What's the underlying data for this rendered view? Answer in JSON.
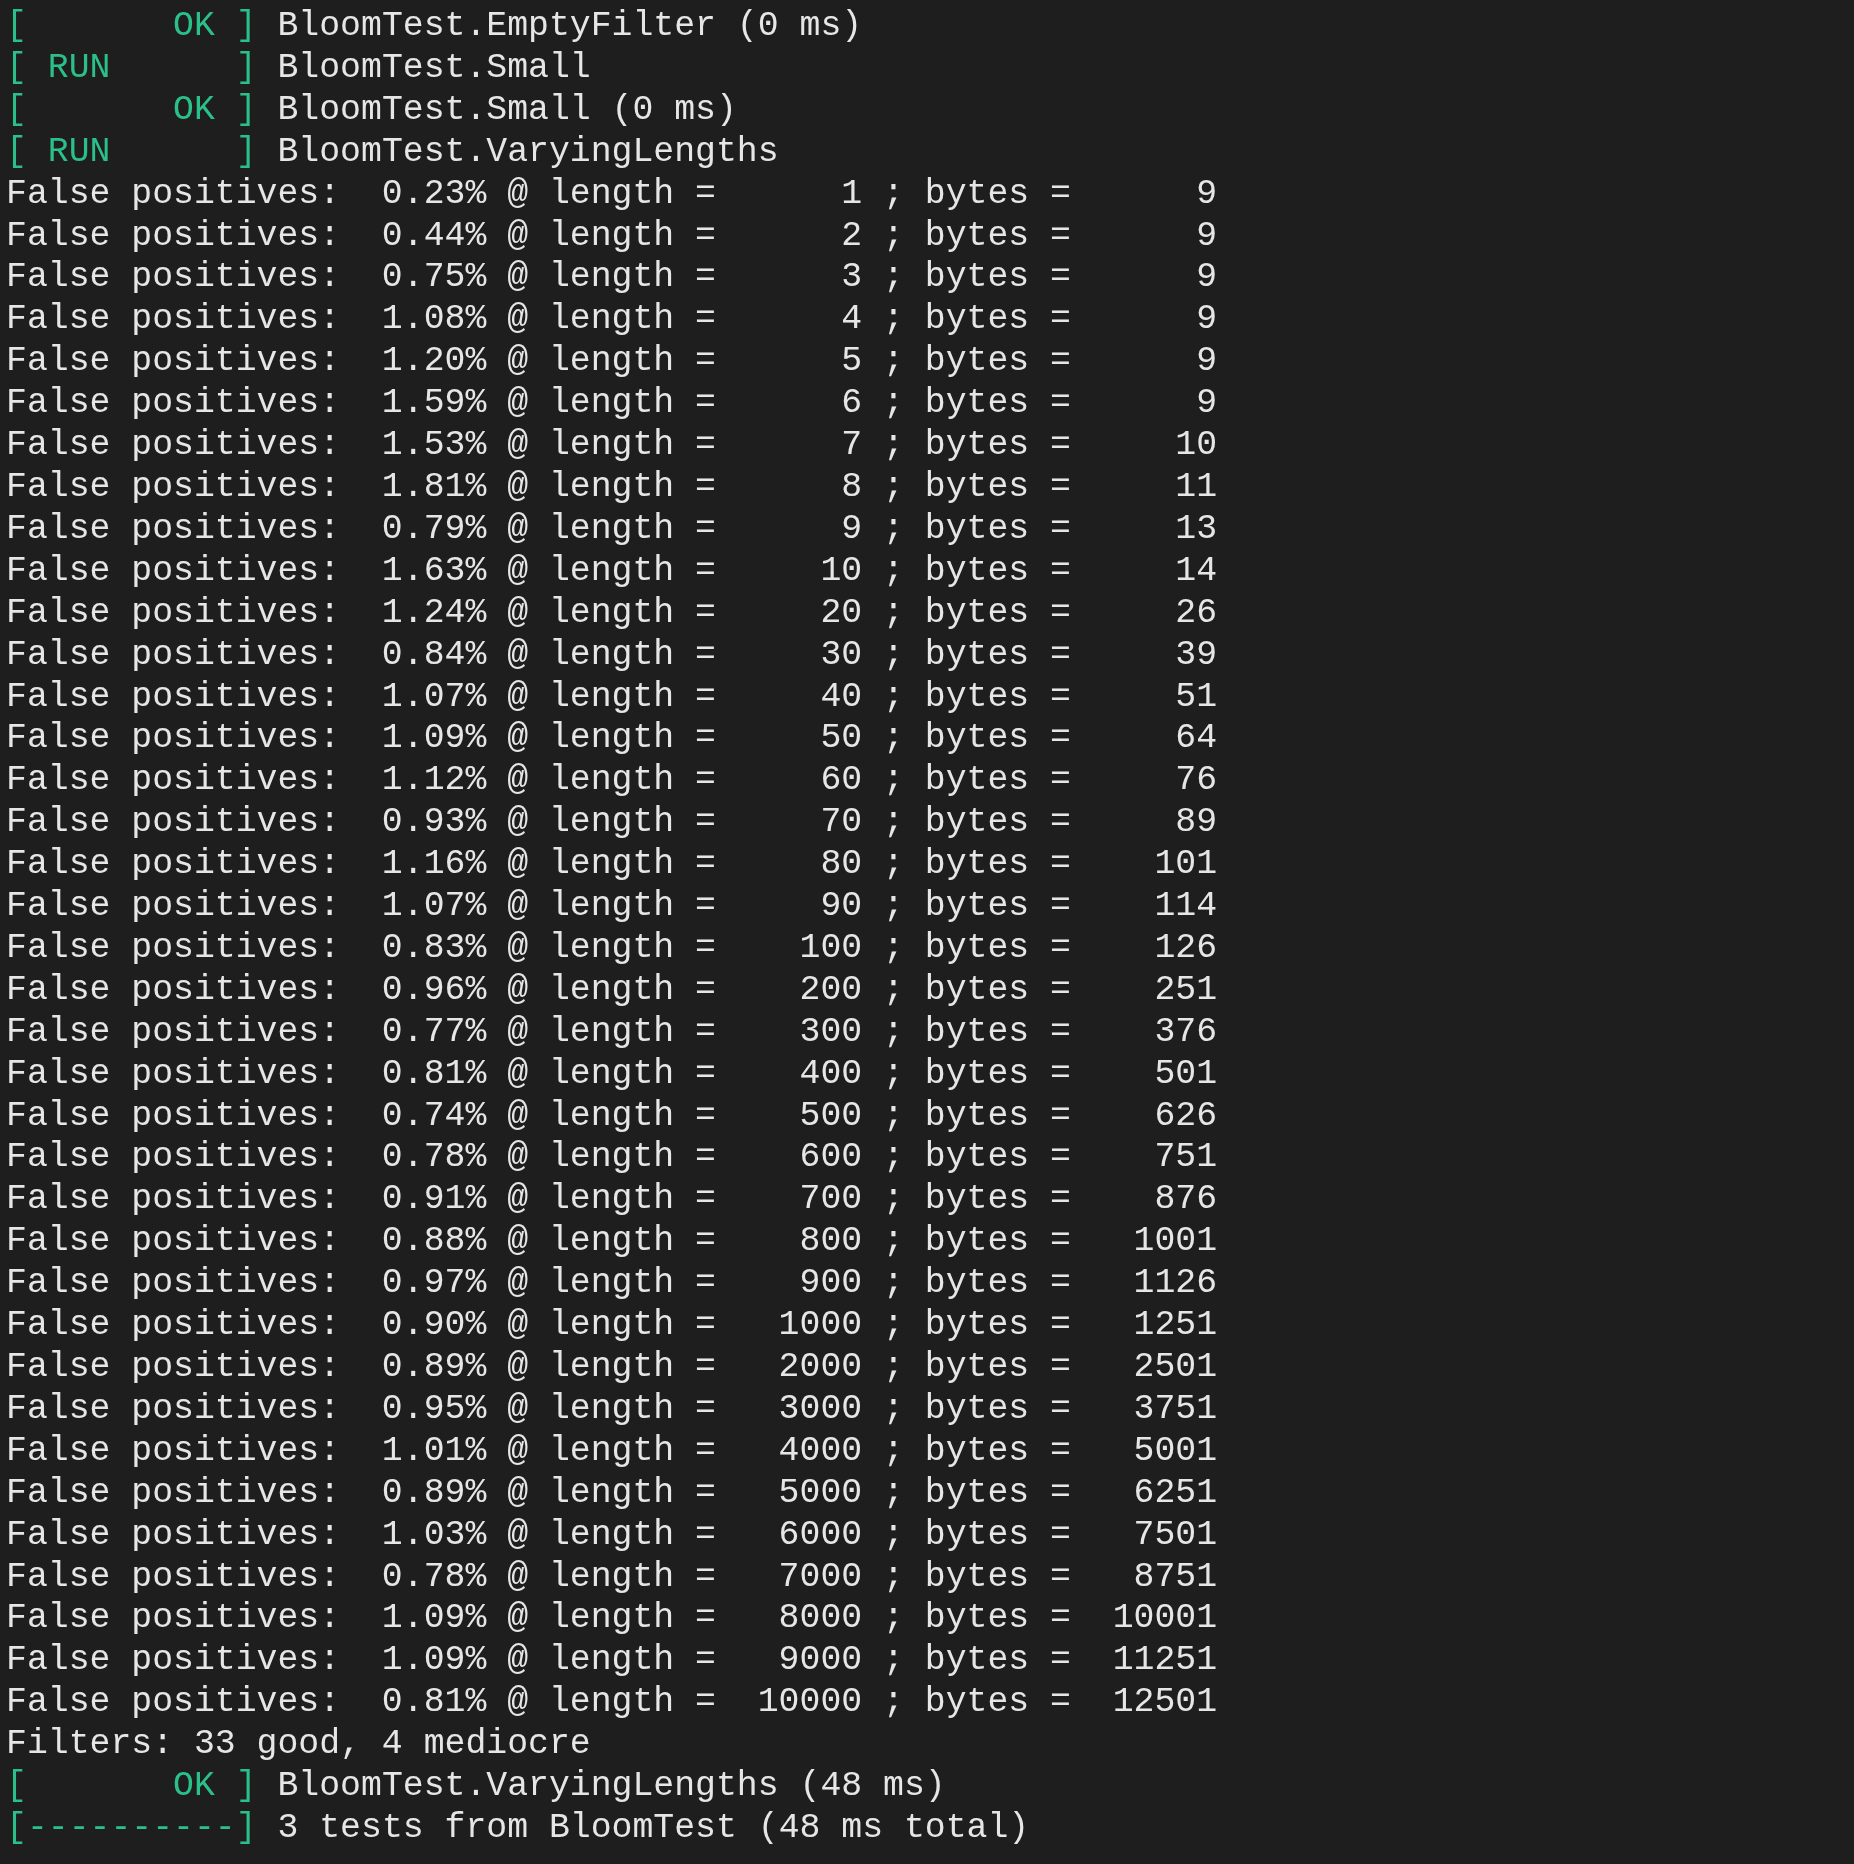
{
  "lines": [
    {
      "kind": "status",
      "tag": "[       OK ]",
      "text": "BloomTest.EmptyFilter (0 ms)"
    },
    {
      "kind": "status",
      "tag": "[ RUN      ]",
      "text": "BloomTest.Small"
    },
    {
      "kind": "status",
      "tag": "[       OK ]",
      "text": "BloomTest.Small (0 ms)"
    },
    {
      "kind": "status",
      "tag": "[ RUN      ]",
      "text": "BloomTest.VaryingLengths"
    },
    {
      "kind": "output",
      "text": "False positives:  0.23% @ length =      1 ; bytes =      9"
    },
    {
      "kind": "output",
      "text": "False positives:  0.44% @ length =      2 ; bytes =      9"
    },
    {
      "kind": "output",
      "text": "False positives:  0.75% @ length =      3 ; bytes =      9"
    },
    {
      "kind": "output",
      "text": "False positives:  1.08% @ length =      4 ; bytes =      9"
    },
    {
      "kind": "output",
      "text": "False positives:  1.20% @ length =      5 ; bytes =      9"
    },
    {
      "kind": "output",
      "text": "False positives:  1.59% @ length =      6 ; bytes =      9"
    },
    {
      "kind": "output",
      "text": "False positives:  1.53% @ length =      7 ; bytes =     10"
    },
    {
      "kind": "output",
      "text": "False positives:  1.81% @ length =      8 ; bytes =     11"
    },
    {
      "kind": "output",
      "text": "False positives:  0.79% @ length =      9 ; bytes =     13"
    },
    {
      "kind": "output",
      "text": "False positives:  1.63% @ length =     10 ; bytes =     14"
    },
    {
      "kind": "output",
      "text": "False positives:  1.24% @ length =     20 ; bytes =     26"
    },
    {
      "kind": "output",
      "text": "False positives:  0.84% @ length =     30 ; bytes =     39"
    },
    {
      "kind": "output",
      "text": "False positives:  1.07% @ length =     40 ; bytes =     51"
    },
    {
      "kind": "output",
      "text": "False positives:  1.09% @ length =     50 ; bytes =     64"
    },
    {
      "kind": "output",
      "text": "False positives:  1.12% @ length =     60 ; bytes =     76"
    },
    {
      "kind": "output",
      "text": "False positives:  0.93% @ length =     70 ; bytes =     89"
    },
    {
      "kind": "output",
      "text": "False positives:  1.16% @ length =     80 ; bytes =    101"
    },
    {
      "kind": "output",
      "text": "False positives:  1.07% @ length =     90 ; bytes =    114"
    },
    {
      "kind": "output",
      "text": "False positives:  0.83% @ length =    100 ; bytes =    126"
    },
    {
      "kind": "output",
      "text": "False positives:  0.96% @ length =    200 ; bytes =    251"
    },
    {
      "kind": "output",
      "text": "False positives:  0.77% @ length =    300 ; bytes =    376"
    },
    {
      "kind": "output",
      "text": "False positives:  0.81% @ length =    400 ; bytes =    501"
    },
    {
      "kind": "output",
      "text": "False positives:  0.74% @ length =    500 ; bytes =    626"
    },
    {
      "kind": "output",
      "text": "False positives:  0.78% @ length =    600 ; bytes =    751"
    },
    {
      "kind": "output",
      "text": "False positives:  0.91% @ length =    700 ; bytes =    876"
    },
    {
      "kind": "output",
      "text": "False positives:  0.88% @ length =    800 ; bytes =   1001"
    },
    {
      "kind": "output",
      "text": "False positives:  0.97% @ length =    900 ; bytes =   1126"
    },
    {
      "kind": "output",
      "text": "False positives:  0.90% @ length =   1000 ; bytes =   1251"
    },
    {
      "kind": "output",
      "text": "False positives:  0.89% @ length =   2000 ; bytes =   2501"
    },
    {
      "kind": "output",
      "text": "False positives:  0.95% @ length =   3000 ; bytes =   3751"
    },
    {
      "kind": "output",
      "text": "False positives:  1.01% @ length =   4000 ; bytes =   5001"
    },
    {
      "kind": "output",
      "text": "False positives:  0.89% @ length =   5000 ; bytes =   6251"
    },
    {
      "kind": "output",
      "text": "False positives:  1.03% @ length =   6000 ; bytes =   7501"
    },
    {
      "kind": "output",
      "text": "False positives:  0.78% @ length =   7000 ; bytes =   8751"
    },
    {
      "kind": "output",
      "text": "False positives:  1.09% @ length =   8000 ; bytes =  10001"
    },
    {
      "kind": "output",
      "text": "False positives:  1.09% @ length =   9000 ; bytes =  11251"
    },
    {
      "kind": "output",
      "text": "False positives:  0.81% @ length =  10000 ; bytes =  12501"
    },
    {
      "kind": "output",
      "text": "Filters: 33 good, 4 mediocre"
    },
    {
      "kind": "status",
      "tag": "[       OK ]",
      "text": "BloomTest.VaryingLengths (48 ms)"
    },
    {
      "kind": "status",
      "tag": "[----------]",
      "text": "3 tests from BloomTest (48 ms total)"
    }
  ]
}
